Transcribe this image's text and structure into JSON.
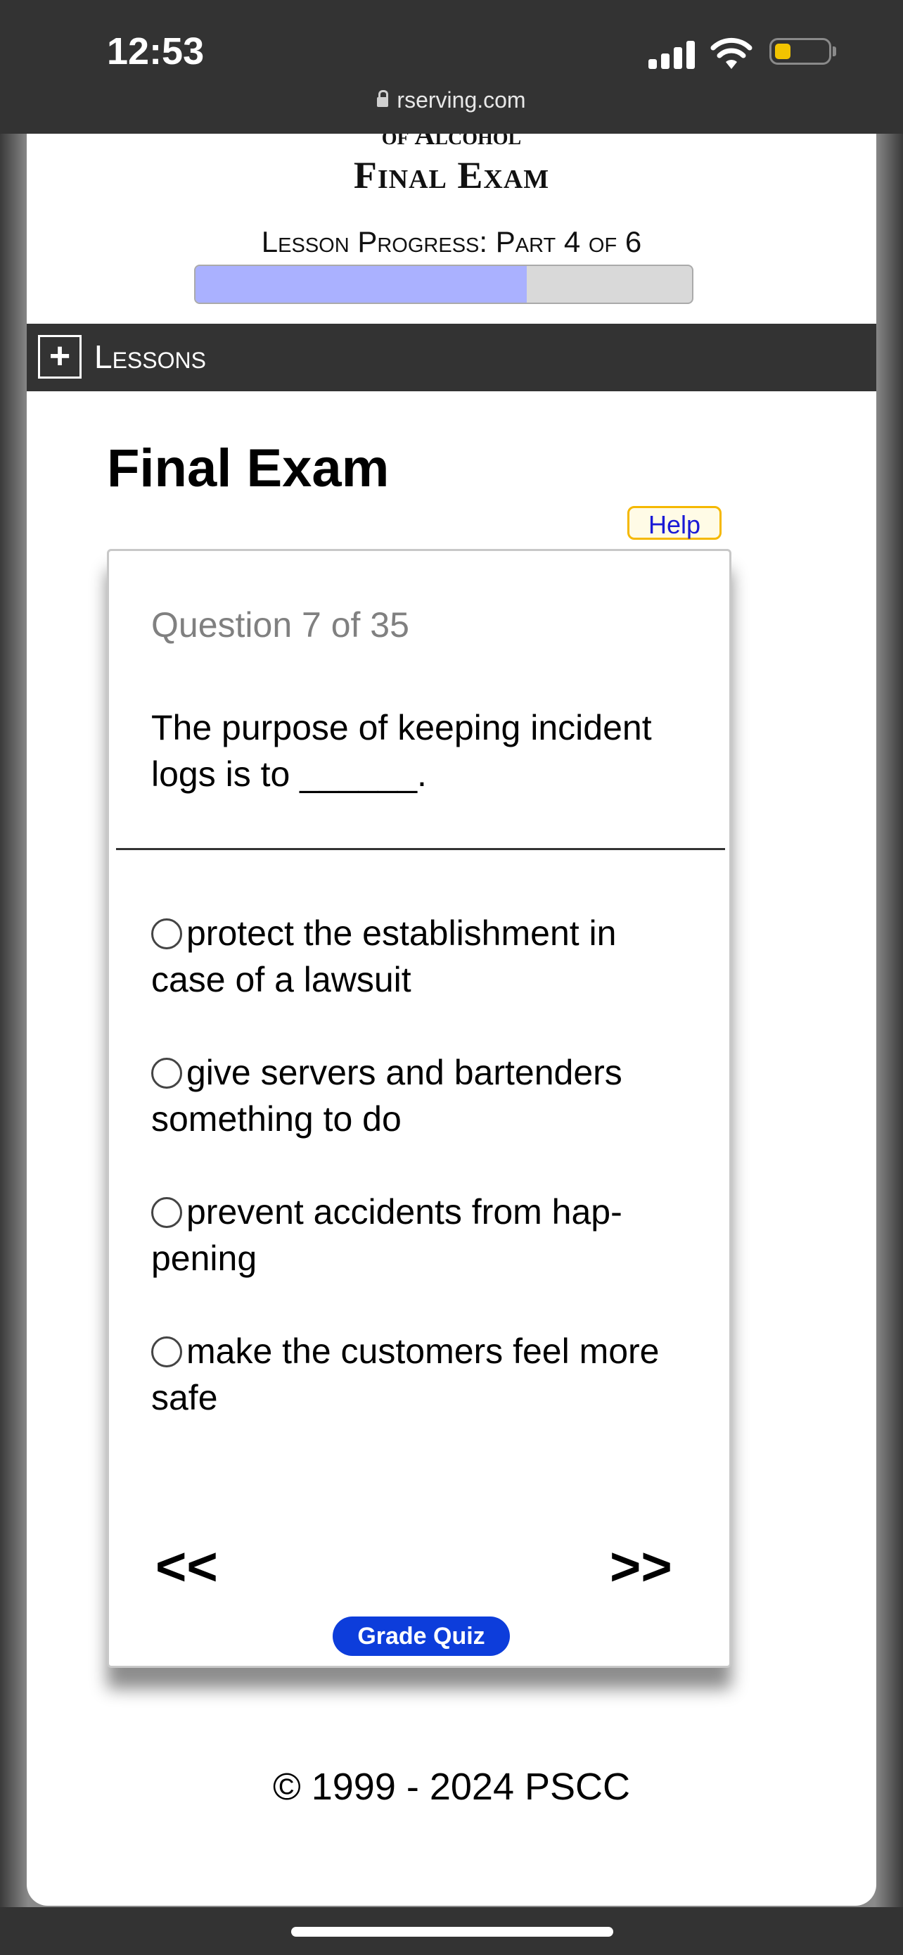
{
  "status_bar": {
    "time": "12:53",
    "url": "rserving.com",
    "battery_color": "#f2c400"
  },
  "header": {
    "course_title": "of Alcohol",
    "exam_title": "Final Exam",
    "progress_label": "Lesson Progress: Part 4 of 6",
    "progress_fraction": 0.667,
    "progress_color": "#aab1ff"
  },
  "lessons_bar": {
    "toggle_icon": "plus-icon",
    "label": "Lessons"
  },
  "main": {
    "heading": "Final Exam",
    "help_label": "Help"
  },
  "quiz": {
    "counter": "Question 7 of 35",
    "question": "The purpose of keeping incident logs is to ______.",
    "options": [
      "protect the establishment in case of a lawsuit",
      "give servers and bartenders something to do",
      "prevent accidents from hap-pening",
      "make the customers feel more safe"
    ],
    "prev_label": "<<",
    "next_label": ">>",
    "grade_label": "Grade Quiz",
    "grade_color": "#0d3ddb"
  },
  "footer": {
    "copyright": "© 1999 - 2024 PSCC"
  }
}
